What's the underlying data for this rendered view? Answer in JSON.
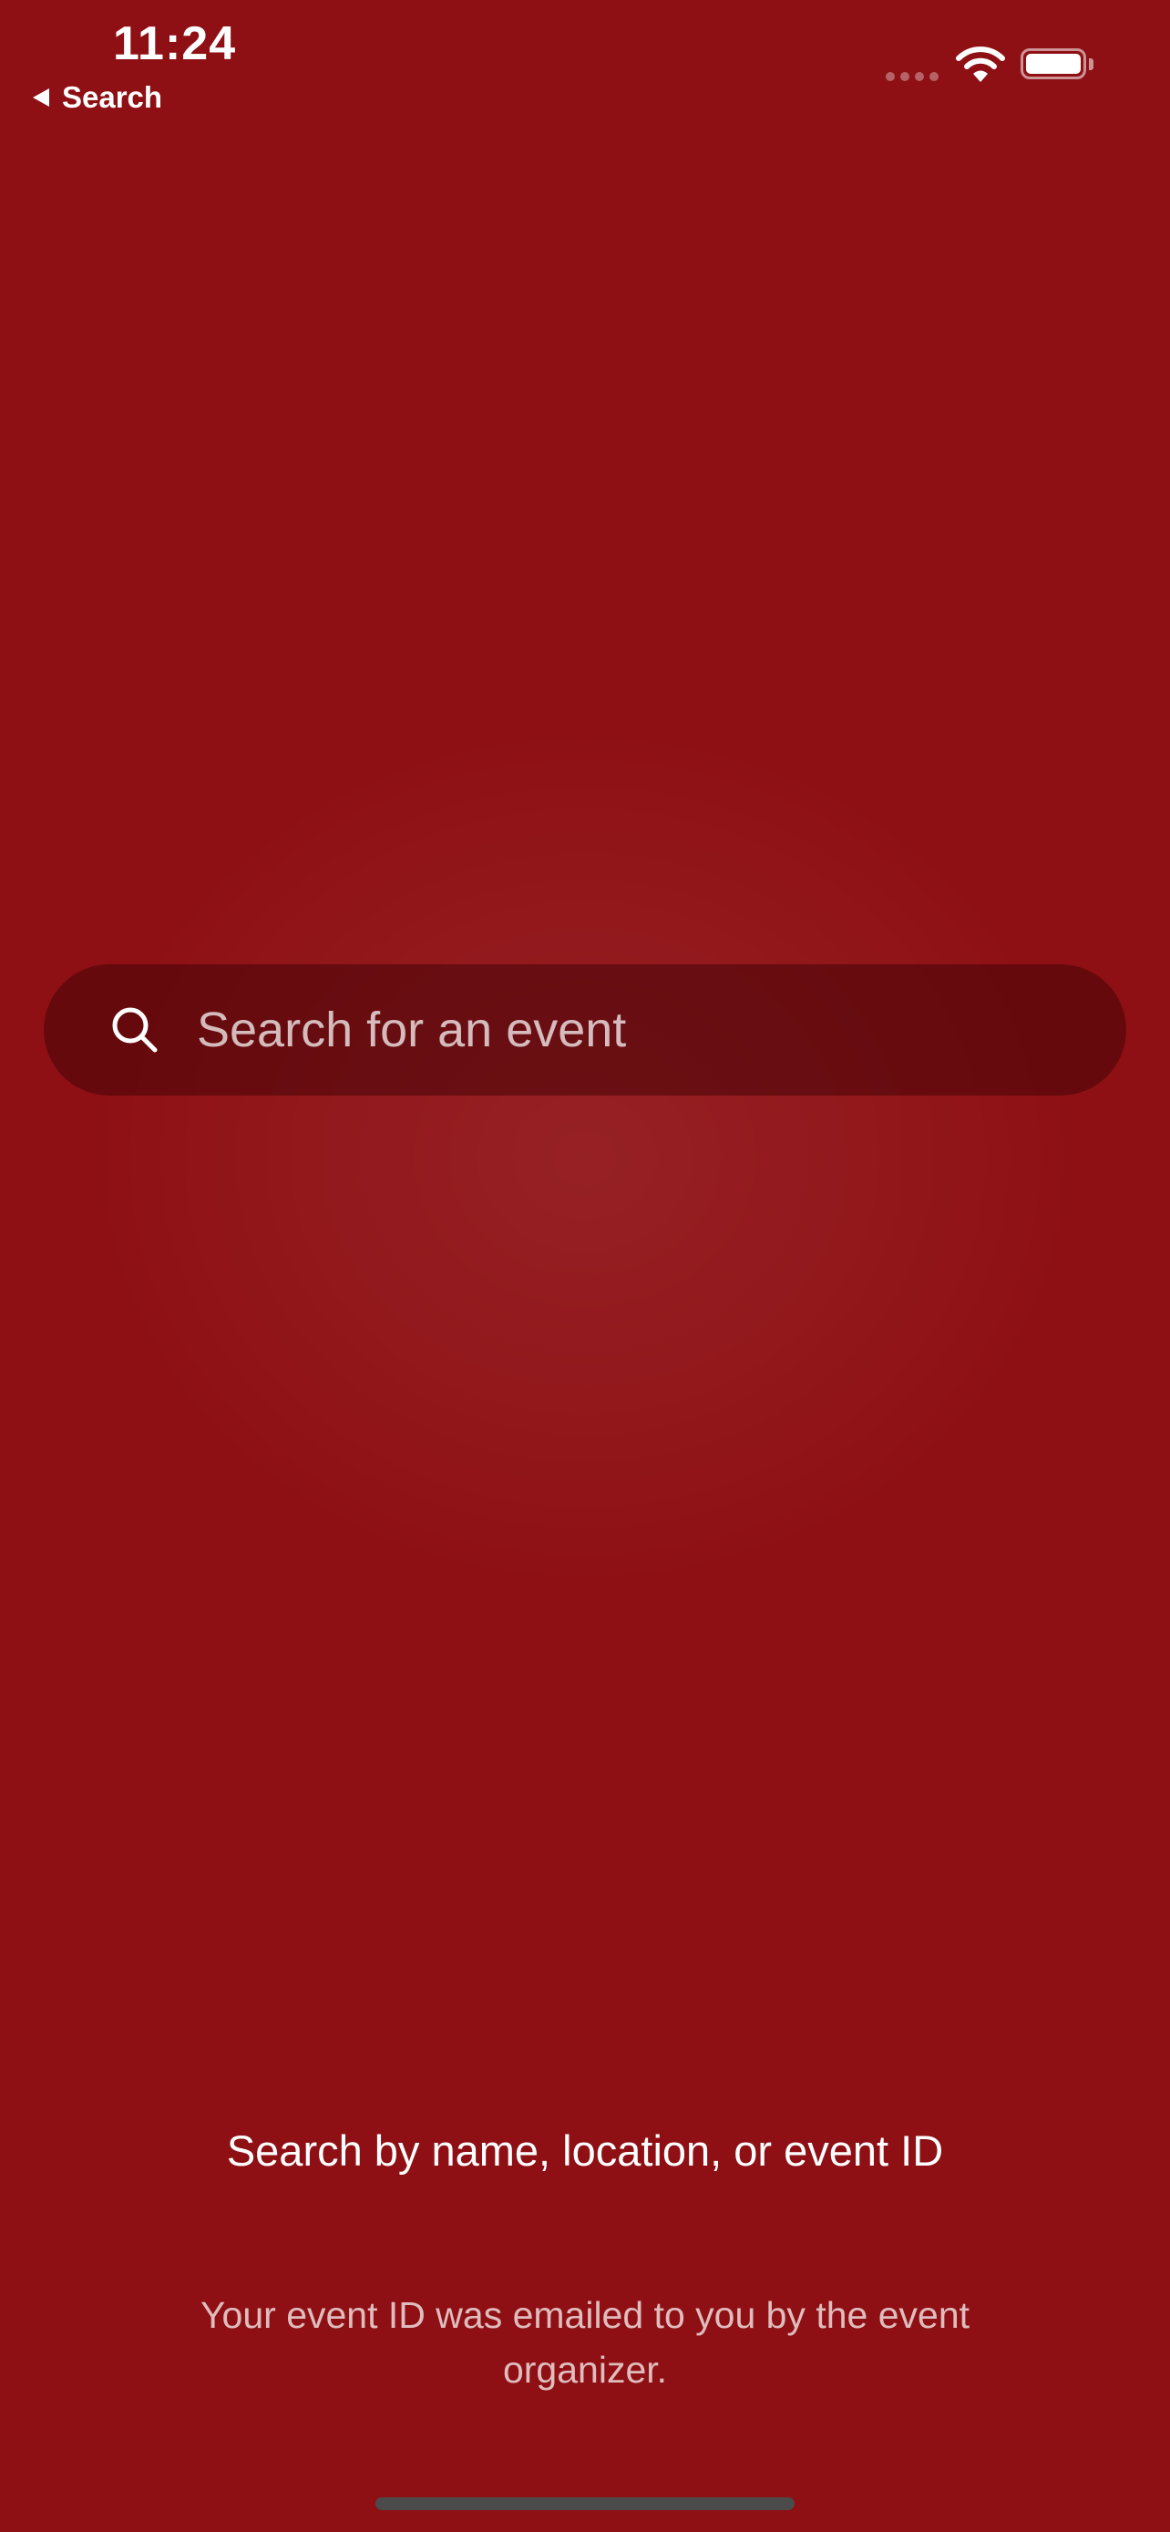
{
  "status_bar": {
    "time": "11:24",
    "back_label": "Search"
  },
  "search": {
    "placeholder": "Search for an event",
    "value": ""
  },
  "hint": {
    "title": "Search by name, location, or event ID",
    "body": "Your event ID was emailed to you by the event organizer."
  },
  "icons": {
    "search": "search-icon",
    "back": "back-arrow-icon",
    "wifi": "wifi-icon",
    "battery": "battery-icon",
    "signal": "cellular-signal-icon"
  },
  "colors": {
    "background": "#8e1014",
    "search_bar": "#5e0a0e",
    "text": "#ffffff"
  }
}
